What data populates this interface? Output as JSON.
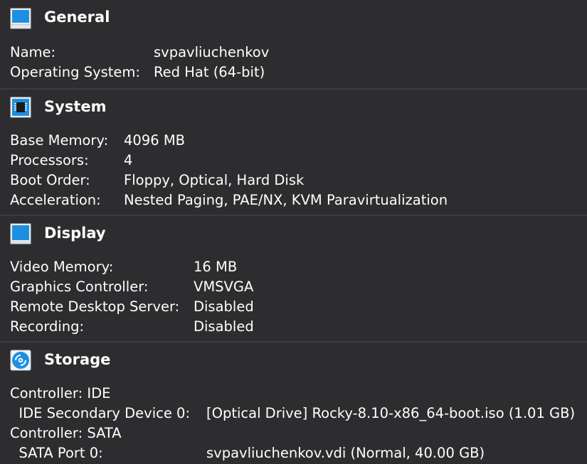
{
  "general": {
    "title": "General",
    "icon": "monitor-icon",
    "rows": [
      {
        "label": "Name:",
        "value": "svpavliuchenkov"
      },
      {
        "label": "Operating System:",
        "value": "Red Hat (64-bit)"
      }
    ]
  },
  "system": {
    "title": "System",
    "icon": "chip-icon",
    "rows": [
      {
        "label": "Base Memory:",
        "value": "4096 MB"
      },
      {
        "label": "Processors:",
        "value": "4"
      },
      {
        "label": "Boot Order:",
        "value": "Floppy, Optical, Hard Disk"
      },
      {
        "label": "Acceleration:",
        "value": "Nested Paging, PAE/NX, KVM Paravirtualization"
      }
    ]
  },
  "display": {
    "title": "Display",
    "icon": "display-icon",
    "rows": [
      {
        "label": "Video Memory:",
        "value": "16 MB"
      },
      {
        "label": "Graphics Controller:",
        "value": "VMSVGA"
      },
      {
        "label": "Remote Desktop Server:",
        "value": "Disabled"
      },
      {
        "label": "Recording:",
        "value": "Disabled"
      }
    ]
  },
  "storage": {
    "title": "Storage",
    "icon": "disk-icon",
    "rows": [
      {
        "label": "Controller: IDE",
        "value": ""
      },
      {
        "label": "  IDE Secondary Device 0:",
        "value": "[Optical Drive] Rocky-8.10-x86_64-boot.iso (1.01 GB)"
      },
      {
        "label": "Controller: SATA",
        "value": ""
      },
      {
        "label": "  SATA Port 0:",
        "value": "svpavliuchenkov.vdi (Normal, 40.00 GB)"
      }
    ]
  },
  "colors": {
    "background": "#2d2d2f",
    "separator": "#3c3c3f",
    "text": "#ffffff",
    "icon_blue": "#1e8fe0"
  }
}
